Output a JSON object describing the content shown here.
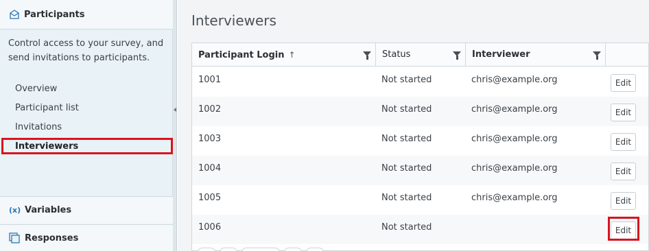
{
  "sidebar": {
    "header": {
      "title": "Participants",
      "icon": "envelope-icon"
    },
    "description": "Control access to your survey, and send invitations to participants.",
    "nav": [
      {
        "label": "Overview",
        "active": false
      },
      {
        "label": "Participant list",
        "active": false
      },
      {
        "label": "Invitations",
        "active": false
      },
      {
        "label": "Interviewers",
        "active": true
      }
    ],
    "sections": [
      {
        "title": "Variables",
        "icon": "variables-icon"
      },
      {
        "title": "Responses",
        "icon": "responses-icon"
      }
    ]
  },
  "main": {
    "title": "Interviewers",
    "table": {
      "columns": [
        "Participant Login",
        "Status",
        "Interviewer"
      ],
      "sort_indicator": "↑",
      "rows": [
        {
          "login": "1001",
          "status": "Not started",
          "interviewer": "chris@example.org",
          "action": "Edit"
        },
        {
          "login": "1002",
          "status": "Not started",
          "interviewer": "chris@example.org",
          "action": "Edit"
        },
        {
          "login": "1003",
          "status": "Not started",
          "interviewer": "chris@example.org",
          "action": "Edit"
        },
        {
          "login": "1004",
          "status": "Not started",
          "interviewer": "chris@example.org",
          "action": "Edit"
        },
        {
          "login": "1005",
          "status": "Not started",
          "interviewer": "chris@example.org",
          "action": "Edit"
        },
        {
          "login": "1006",
          "status": "Not started",
          "interviewer": "",
          "action": "Edit"
        }
      ]
    }
  },
  "colors": {
    "accent": "#2a76b8",
    "highlight": "#d7141f"
  }
}
